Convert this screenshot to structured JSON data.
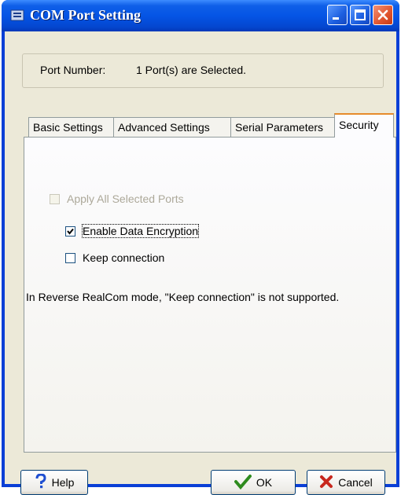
{
  "window": {
    "title": "COM Port Setting"
  },
  "port": {
    "label": "Port Number:",
    "value": "1 Port(s) are Selected."
  },
  "tabs": [
    {
      "label": "Basic Settings",
      "active": false
    },
    {
      "label": "Advanced Settings",
      "active": false
    },
    {
      "label": "Serial Parameters",
      "active": false
    },
    {
      "label": "Security",
      "active": true
    }
  ],
  "security": {
    "apply_all": {
      "label": "Apply All Selected Ports",
      "checked": false,
      "enabled": false
    },
    "encryption": {
      "label": "Enable Data Encryption",
      "checked": true,
      "enabled": true
    },
    "keep_connection": {
      "label": "Keep connection",
      "checked": false,
      "enabled": true
    },
    "note": "In Reverse RealCom mode, \"Keep connection\" is not supported."
  },
  "buttons": {
    "help": "Help",
    "ok": "OK",
    "cancel": "Cancel"
  },
  "colors": {
    "titlebar": "#0555e5",
    "dialog": "#ece9d8",
    "tab_highlight": "#e68b2c",
    "ok_check": "#2e8b1e",
    "cancel_x": "#c8281e",
    "help_question": "#1f4fd1"
  }
}
